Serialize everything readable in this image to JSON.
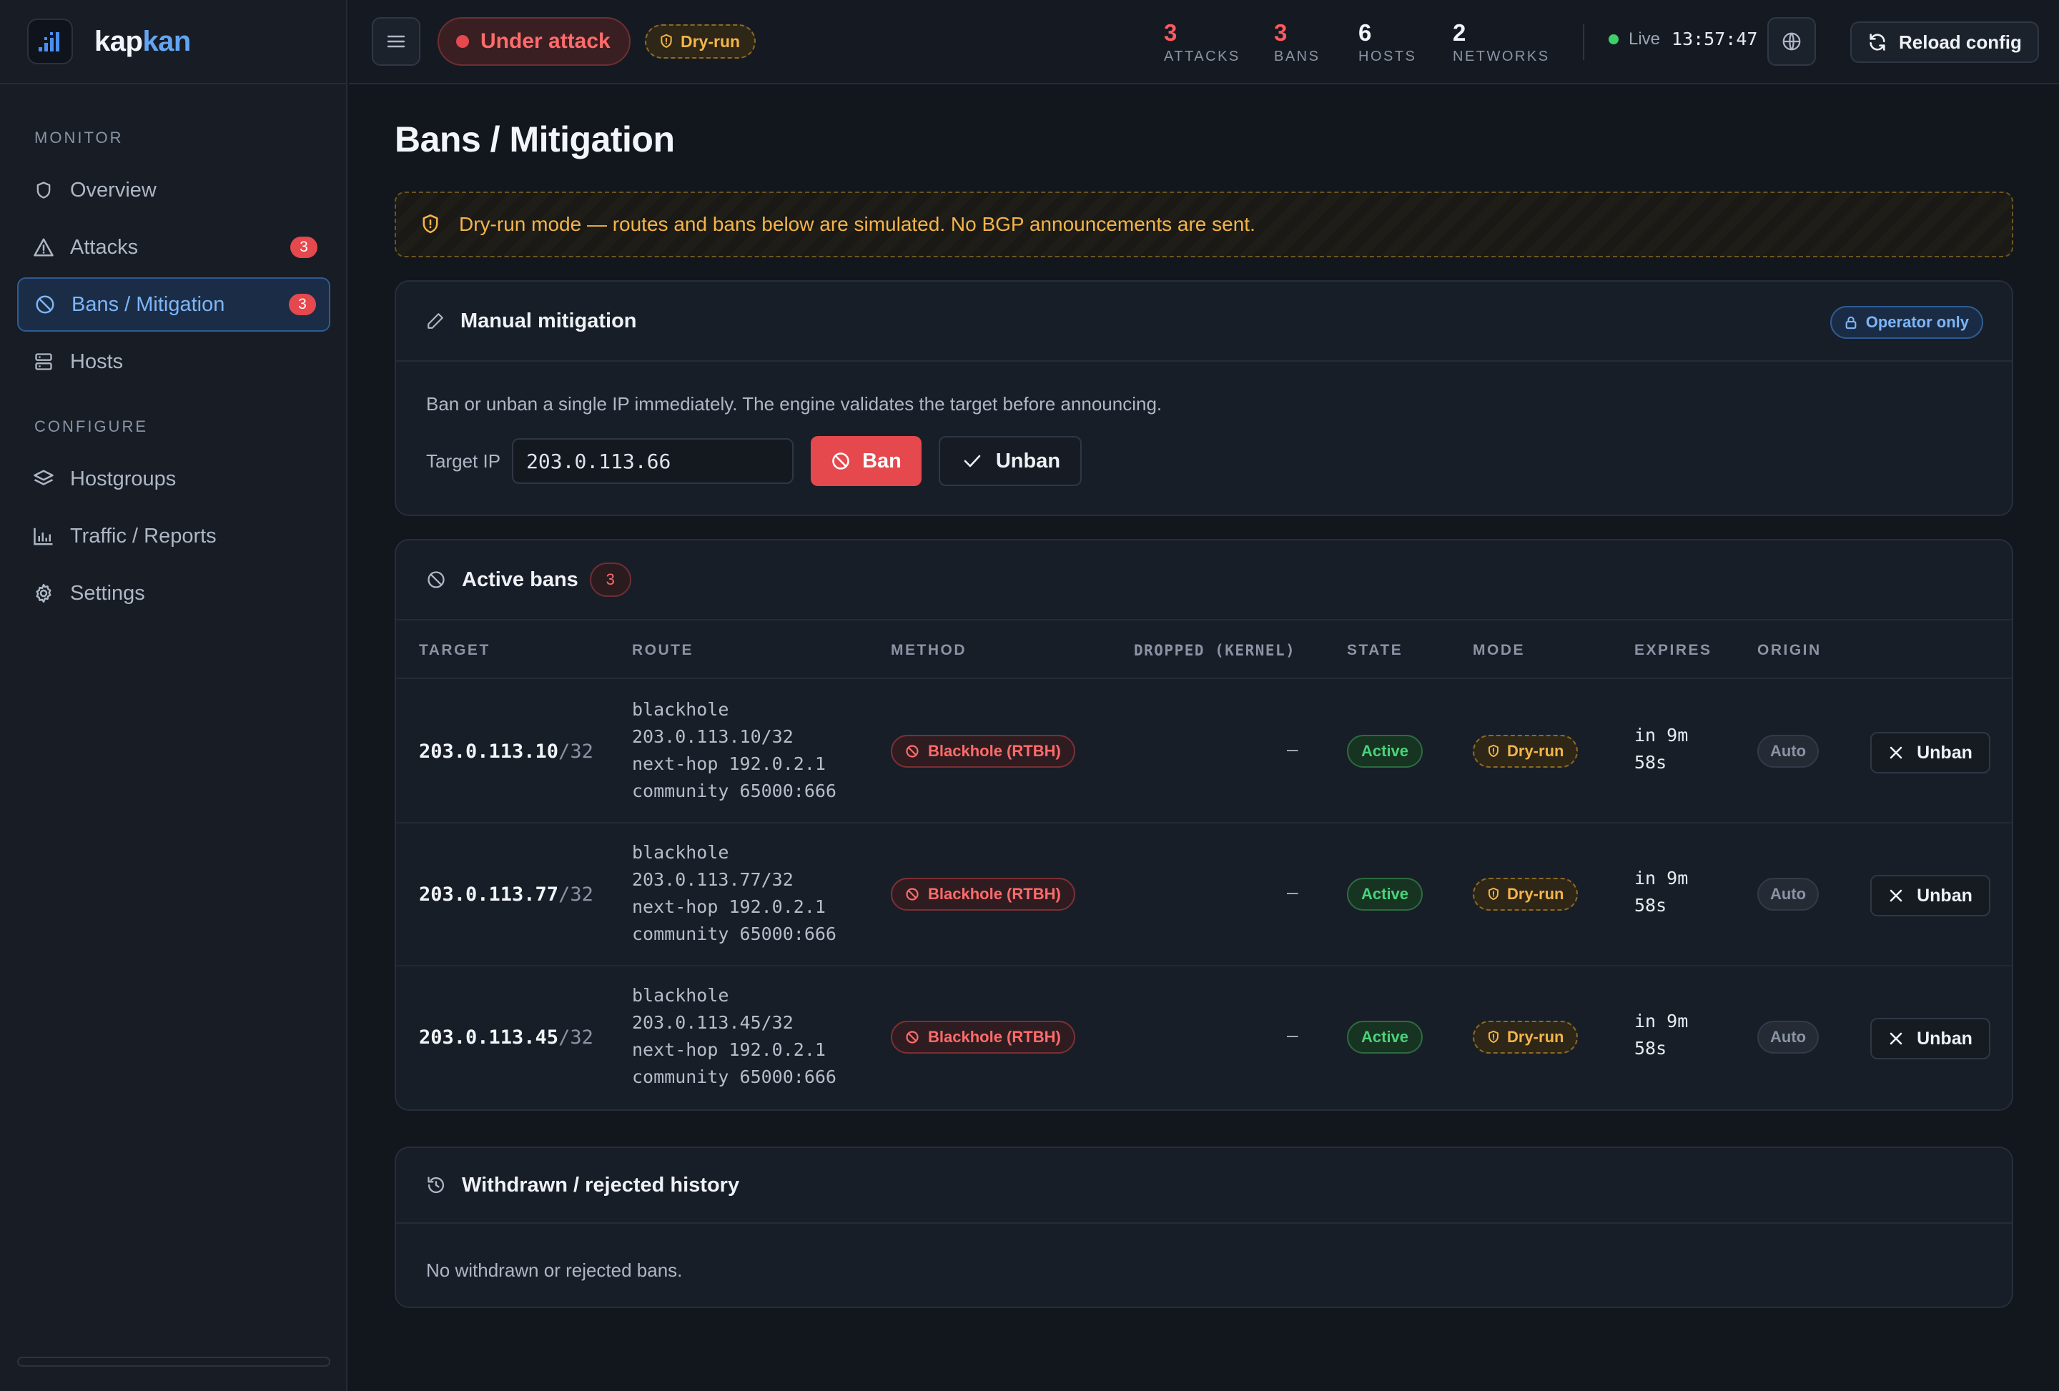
{
  "brand": {
    "name_main": "kap",
    "name_accent": "kan"
  },
  "sidebar": {
    "monitor_label": "MONITOR",
    "configure_label": "CONFIGURE",
    "items": [
      {
        "label": "Overview",
        "icon": "shield-icon"
      },
      {
        "label": "Attacks",
        "icon": "warning-icon",
        "badge": "3"
      },
      {
        "label": "Bans / Mitigation",
        "icon": "ban-icon",
        "badge": "3",
        "active": true
      },
      {
        "label": "Hosts",
        "icon": "server-icon"
      },
      {
        "label": "Hostgroups",
        "icon": "layers-icon"
      },
      {
        "label": "Traffic / Reports",
        "icon": "bar-chart-icon"
      },
      {
        "label": "Settings",
        "icon": "gear-icon"
      }
    ]
  },
  "topbar": {
    "status": "Under attack",
    "mode": "Dry-run",
    "stats": [
      {
        "value": "3",
        "label": "ATTACKS"
      },
      {
        "value": "3",
        "label": "BANS"
      },
      {
        "value": "6",
        "label": "HOSTS"
      },
      {
        "value": "2",
        "label": "NETWORKS"
      }
    ],
    "live_label": "Live",
    "clock": "13:57:47",
    "reload_label": "Reload config"
  },
  "page": {
    "title": "Bans / Mitigation",
    "banner": "Dry-run mode — routes and bans below are simulated. No BGP announcements are sent."
  },
  "manual": {
    "title": "Manual mitigation",
    "badge": "Operator only",
    "description": "Ban or unban a single IP immediately. The engine validates the target before announcing.",
    "target_label": "Target IP",
    "target_value": "203.0.113.66",
    "ban_label": "Ban",
    "unban_label": "Unban"
  },
  "active_bans": {
    "title": "Active bans",
    "count": "3",
    "columns": [
      "TARGET",
      "ROUTE",
      "METHOD",
      "DROPPED (KERNEL)",
      "STATE",
      "MODE",
      "EXPIRES",
      "ORIGIN"
    ],
    "rows": [
      {
        "ip": "203.0.113.10",
        "prefix": "/32",
        "route": "blackhole\n203.0.113.10/32\nnext-hop 192.0.2.1\ncommunity 65000:666",
        "method": "Blackhole (RTBH)",
        "dropped": "—",
        "state": "Active",
        "mode": "Dry-run",
        "expires": "in 9m\n58s",
        "origin": "Auto",
        "action": "Unban"
      },
      {
        "ip": "203.0.113.77",
        "prefix": "/32",
        "route": "blackhole\n203.0.113.77/32\nnext-hop 192.0.2.1\ncommunity 65000:666",
        "method": "Blackhole (RTBH)",
        "dropped": "—",
        "state": "Active",
        "mode": "Dry-run",
        "expires": "in 9m\n58s",
        "origin": "Auto",
        "action": "Unban"
      },
      {
        "ip": "203.0.113.45",
        "prefix": "/32",
        "route": "blackhole\n203.0.113.45/32\nnext-hop 192.0.2.1\ncommunity 65000:666",
        "method": "Blackhole (RTBH)",
        "dropped": "—",
        "state": "Active",
        "mode": "Dry-run",
        "expires": "in 9m\n58s",
        "origin": "Auto",
        "action": "Unban"
      }
    ]
  },
  "history": {
    "title": "Withdrawn / rejected history",
    "empty": "No withdrawn or rejected bans."
  },
  "colors": {
    "accent": "#63a4f3",
    "danger": "#e5484d",
    "warning": "#f3b44a",
    "success": "#4ad37a"
  }
}
